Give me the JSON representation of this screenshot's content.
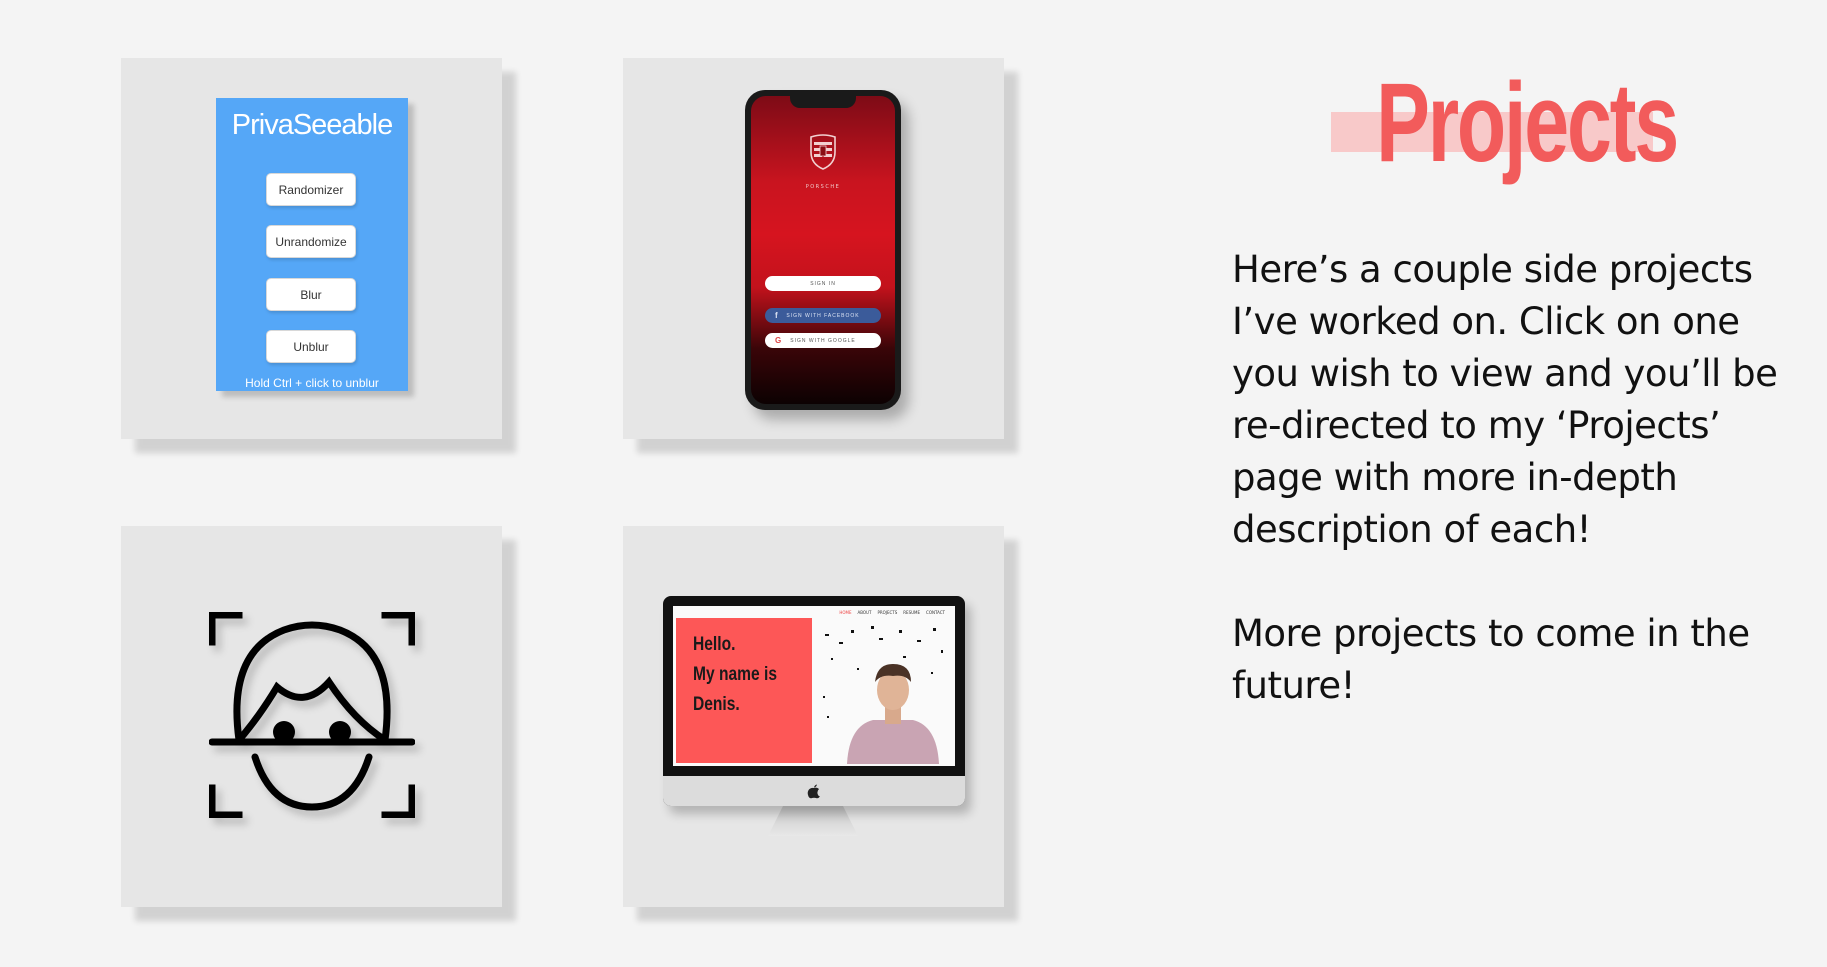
{
  "header": {
    "title": "Projects"
  },
  "intro": {
    "paragraph1": "Here’s a couple side projects I’ve worked on. Click on one you wish to view and you’ll be re-directed to my ‘Projects’ page with more in-depth description of each!",
    "paragraph2": "More projects to come in the future!"
  },
  "projects": {
    "privaseeable": {
      "title": "PrivaSeeable",
      "buttons": [
        "Randomizer",
        "Unrandomize",
        "Blur",
        "Unblur"
      ],
      "hint": "Hold Ctrl + click to unblur",
      "color": "#55a7f7"
    },
    "porsche": {
      "brand": "PORSCHE",
      "sign_in": "SIGN IN",
      "facebook": "SIGN WITH FACEBOOK",
      "google": "SIGN WITH GOOGLE",
      "color": "#d6141f"
    },
    "face_id": {
      "icon": "face-scan-icon"
    },
    "portfolio": {
      "hero_line1": "Hello.",
      "hero_line2": "My name is",
      "hero_line3": "Denis.",
      "nav": [
        "HOME",
        "ABOUT",
        "PROJECTS",
        "RESUME",
        "CONTACT"
      ],
      "color": "#fd5757"
    }
  },
  "colors": {
    "background": "#f4f4f4",
    "card": "#e6e6e6",
    "accent": "#f25b5b",
    "accent_light": "#f8c9c9"
  }
}
